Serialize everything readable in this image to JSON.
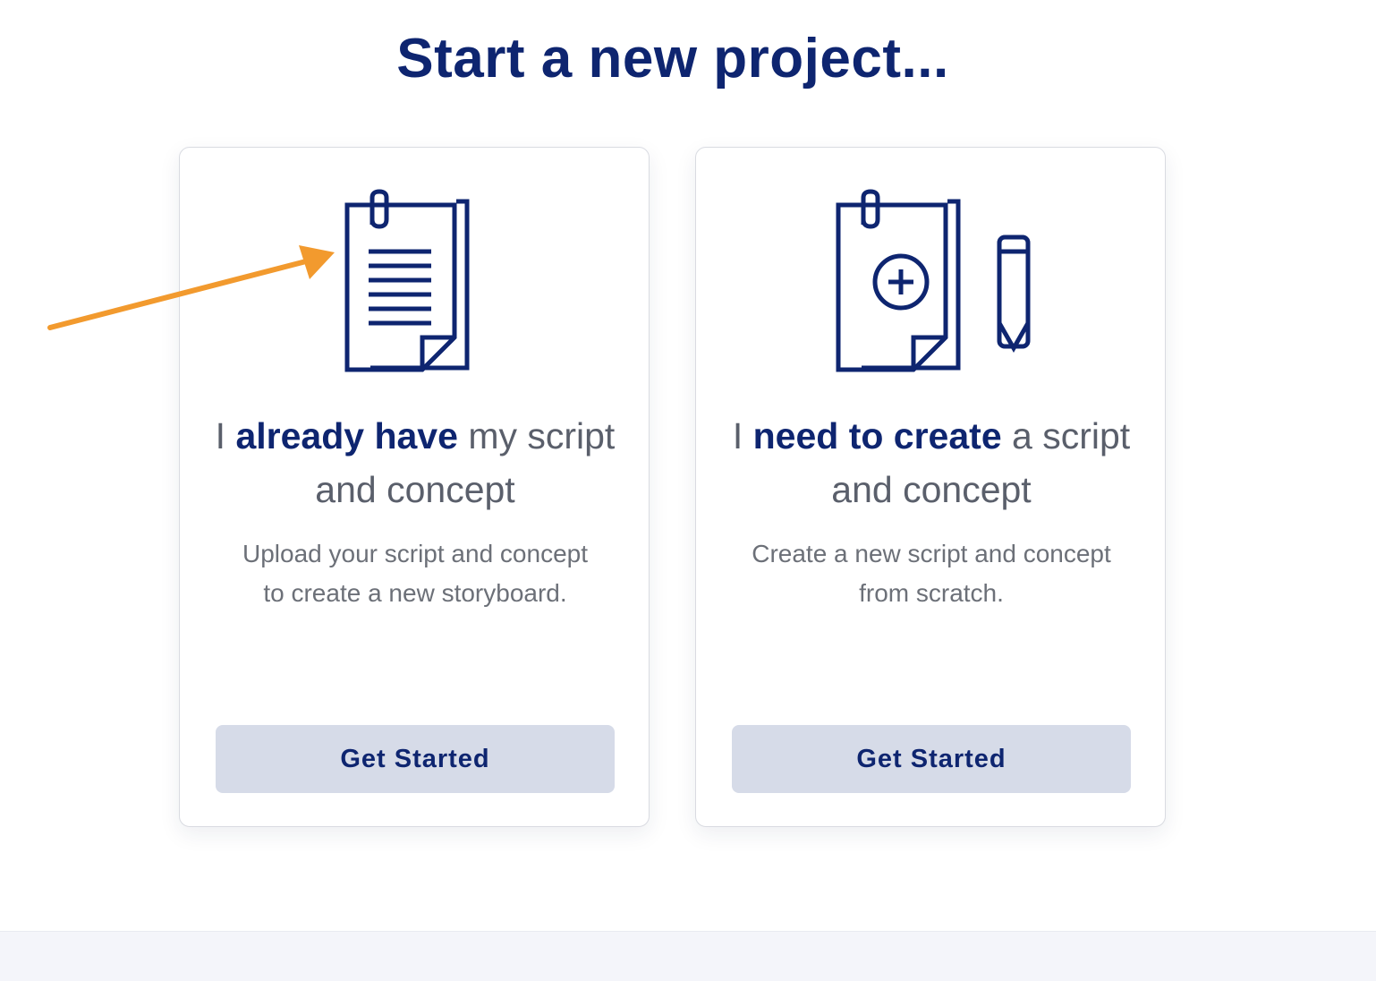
{
  "page": {
    "title": "Start a new project..."
  },
  "colors": {
    "brand": "#0e2570",
    "button_bg": "#d6dbe8",
    "annotation_arrow": "#f29a2e"
  },
  "cards": [
    {
      "icon": "script-document-icon",
      "heading_pre": "I ",
      "heading_em": "already have",
      "heading_post": " my script and concept",
      "description": "Upload your script and concept to create a new storyboard.",
      "button_label": "Get Started"
    },
    {
      "icon": "new-document-pencil-icon",
      "heading_pre": "I ",
      "heading_em": "need to create",
      "heading_post": " a script and concept",
      "description": "Create a new script and concept from scratch.",
      "button_label": "Get Started"
    }
  ]
}
